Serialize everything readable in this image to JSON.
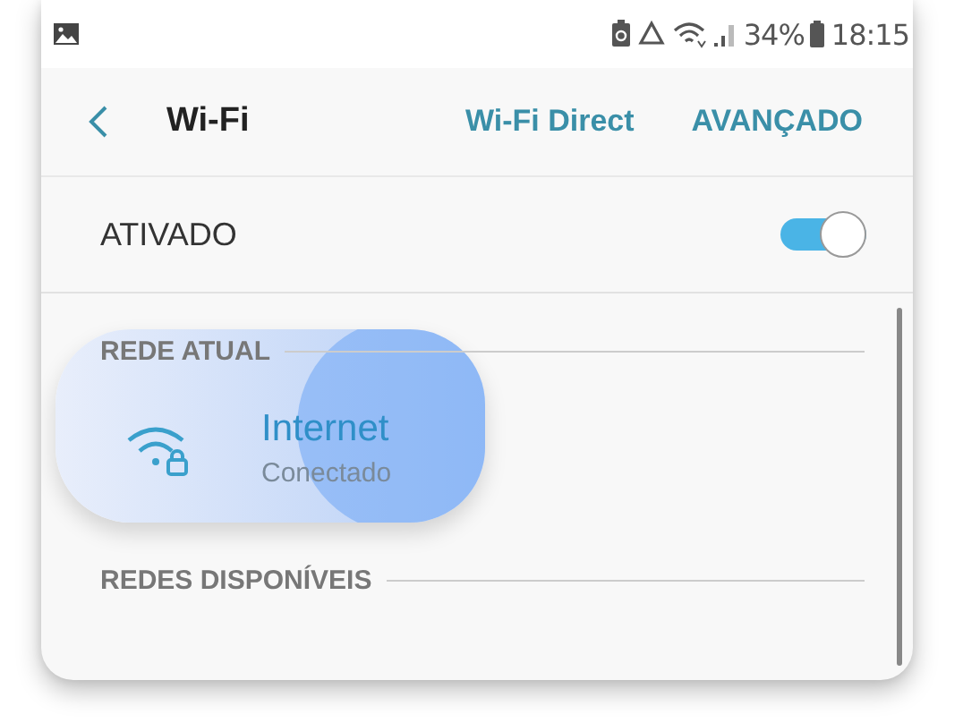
{
  "status_bar": {
    "battery": "34%",
    "time": "18:15"
  },
  "header": {
    "title": "Wi-Fi",
    "actions": [
      "Wi-Fi Direct",
      "AVANÇADO"
    ]
  },
  "wifi_switch": {
    "label": "ATIVADO",
    "on": true
  },
  "sections": [
    {
      "title": "REDE ATUAL",
      "networks": [
        {
          "name": "Internet",
          "status": "Conectado",
          "pressed": true
        }
      ]
    },
    {
      "title": "REDES DISPONÍVEIS"
    }
  ]
}
